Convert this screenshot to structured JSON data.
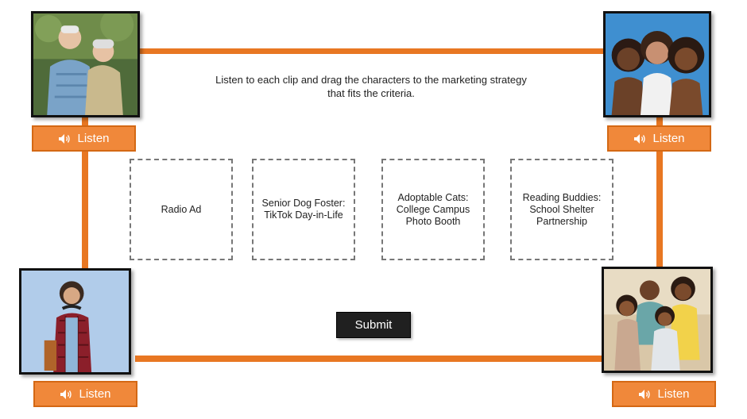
{
  "instructions": "Listen to each clip and drag the characters to the marketing strategy that fits the criteria.",
  "listen_label": "Listen",
  "dropzones": [
    "Radio Ad",
    "Senior Dog Foster:\nTikTok Day-in-Life",
    "Adoptable Cats:\nCollege Campus\nPhoto Booth",
    "Reading Buddies:\nSchool Shelter\nPartnership"
  ],
  "submit_label": "Submit",
  "colors": {
    "accent_orange": "#e87722",
    "button_orange": "#f0883a",
    "submit_bg": "#202020"
  },
  "characters": [
    {
      "name": "elderly-couple-photo"
    },
    {
      "name": "three-young-women-photo"
    },
    {
      "name": "teen-student-photo"
    },
    {
      "name": "family-photo"
    }
  ]
}
